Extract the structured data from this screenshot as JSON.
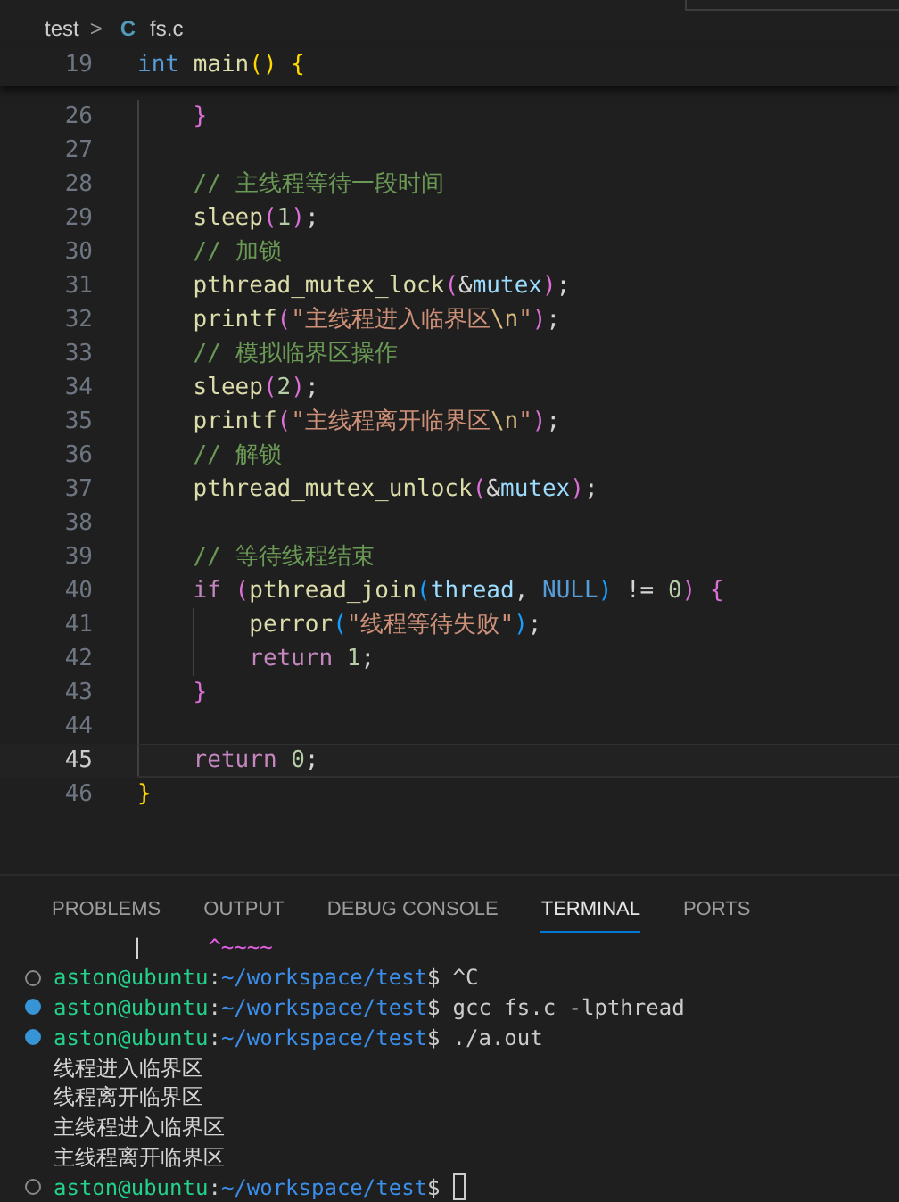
{
  "breadcrumb": {
    "folder": "test",
    "separator": ">",
    "file_icon": "C",
    "file": "fs.c"
  },
  "sticky_line": {
    "number": "19",
    "tokens": [
      {
        "text": "int ",
        "kind": "type"
      },
      {
        "text": "main",
        "kind": "func"
      },
      {
        "text": "() ",
        "kind": "b1"
      },
      {
        "text": "{",
        "kind": "b1"
      }
    ]
  },
  "code_lines": [
    {
      "number": "26",
      "current": false,
      "tokens": [
        {
          "text": "    }",
          "kind": "b2"
        }
      ]
    },
    {
      "number": "27",
      "current": false
    },
    {
      "number": "28",
      "current": false,
      "tokens": [
        {
          "text": "    // 主线程等待一段时间",
          "kind": "comment"
        }
      ]
    },
    {
      "number": "29",
      "current": false,
      "tokens": [
        {
          "text": "    sleep",
          "kind": "func"
        },
        {
          "text": "(",
          "kind": "b2"
        },
        {
          "text": "1",
          "kind": "number"
        },
        {
          "text": ")",
          "kind": "b2"
        },
        {
          "text": ";",
          "kind": "plain"
        }
      ]
    },
    {
      "number": "30",
      "current": false,
      "tokens": [
        {
          "text": "    // 加锁",
          "kind": "comment"
        }
      ]
    },
    {
      "number": "31",
      "current": false,
      "tokens": [
        {
          "text": "    pthread_mutex_lock",
          "kind": "func"
        },
        {
          "text": "(",
          "kind": "b2"
        },
        {
          "text": "&",
          "kind": "plain"
        },
        {
          "text": "mutex",
          "kind": "var"
        },
        {
          "text": ")",
          "kind": "b2"
        },
        {
          "text": ";",
          "kind": "plain"
        }
      ]
    },
    {
      "number": "32",
      "current": false,
      "tokens": [
        {
          "text": "    printf",
          "kind": "func"
        },
        {
          "text": "(",
          "kind": "b2"
        },
        {
          "text": "\"主线程进入临界区",
          "kind": "string"
        },
        {
          "text": "\\n",
          "kind": "escape"
        },
        {
          "text": "\"",
          "kind": "string"
        },
        {
          "text": ")",
          "kind": "b2"
        },
        {
          "text": ";",
          "kind": "plain"
        }
      ]
    },
    {
      "number": "33",
      "current": false,
      "tokens": [
        {
          "text": "    // 模拟临界区操作",
          "kind": "comment"
        }
      ]
    },
    {
      "number": "34",
      "current": false,
      "tokens": [
        {
          "text": "    sleep",
          "kind": "func"
        },
        {
          "text": "(",
          "kind": "b2"
        },
        {
          "text": "2",
          "kind": "number"
        },
        {
          "text": ")",
          "kind": "b2"
        },
        {
          "text": ";",
          "kind": "plain"
        }
      ]
    },
    {
      "number": "35",
      "current": false,
      "tokens": [
        {
          "text": "    printf",
          "kind": "func"
        },
        {
          "text": "(",
          "kind": "b2"
        },
        {
          "text": "\"主线程离开临界区",
          "kind": "string"
        },
        {
          "text": "\\n",
          "kind": "escape"
        },
        {
          "text": "\"",
          "kind": "string"
        },
        {
          "text": ")",
          "kind": "b2"
        },
        {
          "text": ";",
          "kind": "plain"
        }
      ]
    },
    {
      "number": "36",
      "current": false,
      "tokens": [
        {
          "text": "    // 解锁",
          "kind": "comment"
        }
      ]
    },
    {
      "number": "37",
      "current": false,
      "tokens": [
        {
          "text": "    pthread_mutex_unlock",
          "kind": "func"
        },
        {
          "text": "(",
          "kind": "b2"
        },
        {
          "text": "&",
          "kind": "plain"
        },
        {
          "text": "mutex",
          "kind": "var"
        },
        {
          "text": ")",
          "kind": "b2"
        },
        {
          "text": ";",
          "kind": "plain"
        }
      ]
    },
    {
      "number": "38",
      "current": false
    },
    {
      "number": "39",
      "current": false,
      "tokens": [
        {
          "text": "    // 等待线程结束",
          "kind": "comment"
        }
      ]
    },
    {
      "number": "40",
      "current": false,
      "tokens": [
        {
          "text": "    if ",
          "kind": "control"
        },
        {
          "text": "(",
          "kind": "b2"
        },
        {
          "text": "pthread_join",
          "kind": "func"
        },
        {
          "text": "(",
          "kind": "b3"
        },
        {
          "text": "thread",
          "kind": "var"
        },
        {
          "text": ", ",
          "kind": "plain"
        },
        {
          "text": "NULL",
          "kind": "type"
        },
        {
          "text": ")",
          "kind": "b3"
        },
        {
          "text": " != ",
          "kind": "plain"
        },
        {
          "text": "0",
          "kind": "number"
        },
        {
          "text": ") ",
          "kind": "b2"
        },
        {
          "text": "{",
          "kind": "b2"
        }
      ]
    },
    {
      "number": "41",
      "current": false,
      "tokens": [
        {
          "text": "        perror",
          "kind": "func"
        },
        {
          "text": "(",
          "kind": "b3"
        },
        {
          "text": "\"线程等待失败\"",
          "kind": "string"
        },
        {
          "text": ")",
          "kind": "b3"
        },
        {
          "text": ";",
          "kind": "plain"
        }
      ]
    },
    {
      "number": "42",
      "current": false,
      "tokens": [
        {
          "text": "        return ",
          "kind": "control"
        },
        {
          "text": "1",
          "kind": "number"
        },
        {
          "text": ";",
          "kind": "plain"
        }
      ]
    },
    {
      "number": "43",
      "current": false,
      "tokens": [
        {
          "text": "    }",
          "kind": "b2"
        }
      ]
    },
    {
      "number": "44",
      "current": false
    },
    {
      "number": "45",
      "current": true,
      "tokens": [
        {
          "text": "    return ",
          "kind": "control"
        },
        {
          "text": "0",
          "kind": "number"
        },
        {
          "text": ";",
          "kind": "plain"
        }
      ]
    },
    {
      "number": "46",
      "current": false,
      "tokens": [
        {
          "text": "}",
          "kind": "b1"
        }
      ]
    }
  ],
  "panel_tabs": [
    {
      "label": "PROBLEMS",
      "selected": false
    },
    {
      "label": "OUTPUT",
      "selected": false
    },
    {
      "label": "DEBUG CONSOLE",
      "selected": false
    },
    {
      "label": "TERMINAL",
      "selected": true
    },
    {
      "label": "PORTS",
      "selected": false
    }
  ],
  "terminal_lines": [
    {
      "kind": "output",
      "tokens": [
        {
          "text": "      |     ",
          "kind": "plain"
        },
        {
          "text": "^~~~~",
          "kind": "squiggle"
        }
      ]
    },
    {
      "kind": "prompt",
      "succeeded": false,
      "user": "aston@ubuntu",
      "colon": ":",
      "path": "~/workspace/test",
      "dollar": "$",
      "command": "^C"
    },
    {
      "kind": "prompt",
      "succeeded": true,
      "user": "aston@ubuntu",
      "colon": ":",
      "path": "~/workspace/test",
      "dollar": "$",
      "command": "gcc fs.c -lpthread"
    },
    {
      "kind": "prompt",
      "succeeded": true,
      "user": "aston@ubuntu",
      "colon": ":",
      "path": "~/workspace/test",
      "dollar": "$",
      "command": "./a.out"
    },
    {
      "kind": "output",
      "tokens": [
        {
          "text": "线程进入临界区",
          "kind": "plain"
        }
      ]
    },
    {
      "kind": "output",
      "tokens": [
        {
          "text": "线程离开临界区",
          "kind": "plain"
        }
      ]
    },
    {
      "kind": "output",
      "tokens": [
        {
          "text": "主线程进入临界区",
          "kind": "plain"
        }
      ]
    },
    {
      "kind": "output",
      "tokens": [
        {
          "text": "主线程离开临界区",
          "kind": "plain"
        }
      ]
    },
    {
      "kind": "prompt",
      "succeeded": false,
      "user": "aston@ubuntu",
      "colon": ":",
      "path": "~/workspace/test",
      "dollar": "$",
      "cursor": true
    }
  ]
}
